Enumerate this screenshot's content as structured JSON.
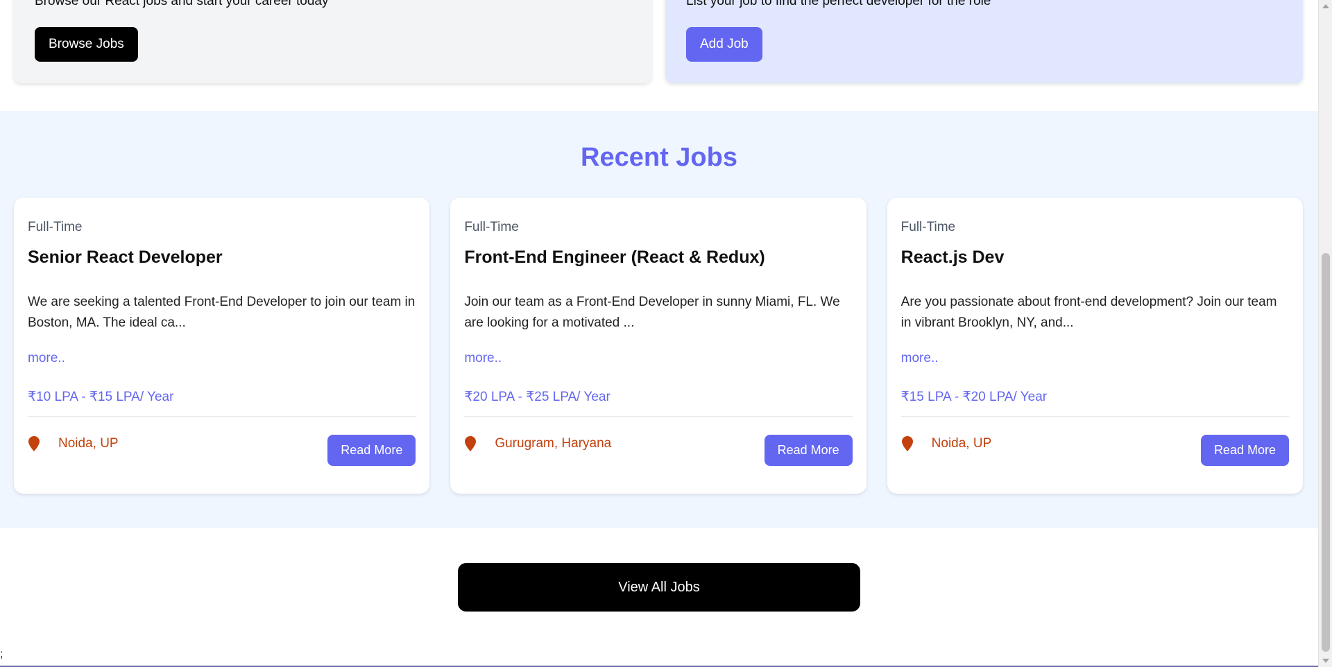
{
  "promo": {
    "developers": {
      "text": "Browse our React jobs and start your career today",
      "button_label": "Browse Jobs"
    },
    "employers": {
      "text": "List your job to find the perfect developer for the role",
      "button_label": "Add Job"
    }
  },
  "recent_jobs": {
    "title": "Recent Jobs",
    "jobs": [
      {
        "type": "Full-Time",
        "title": "Senior React Developer",
        "description": "We are seeking a talented Front-End Developer to join our team in Boston, MA. The ideal ca...",
        "more_label": "more..",
        "salary": "₹10 LPA - ₹15 LPA/ Year",
        "location": "Noida, UP",
        "button_label": "Read More"
      },
      {
        "type": "Full-Time",
        "title": "Front-End Engineer (React & Redux)",
        "description": "Join our team as a Front-End Developer in sunny Miami, FL. We are looking for a motivated ...",
        "more_label": "more..",
        "salary": "₹20 LPA - ₹25 LPA/ Year",
        "location": "Gurugram, Haryana",
        "button_label": "Read More"
      },
      {
        "type": "Full-Time",
        "title": "React.js Dev",
        "description": "Are you passionate about front-end development? Join our team in vibrant Brooklyn, NY, and...",
        "more_label": "more..",
        "salary": "₹15 LPA - ₹20 LPA/ Year",
        "location": "Noida, UP",
        "button_label": "Read More"
      }
    ]
  },
  "view_all_label": "View All Jobs",
  "stray_text": ";",
  "colors": {
    "accent": "#6366f1",
    "location": "#c2410c",
    "section_bg": "#eff6ff",
    "employer_bg": "#e0e7ff"
  },
  "icons": {
    "location": "map-pin-icon"
  }
}
